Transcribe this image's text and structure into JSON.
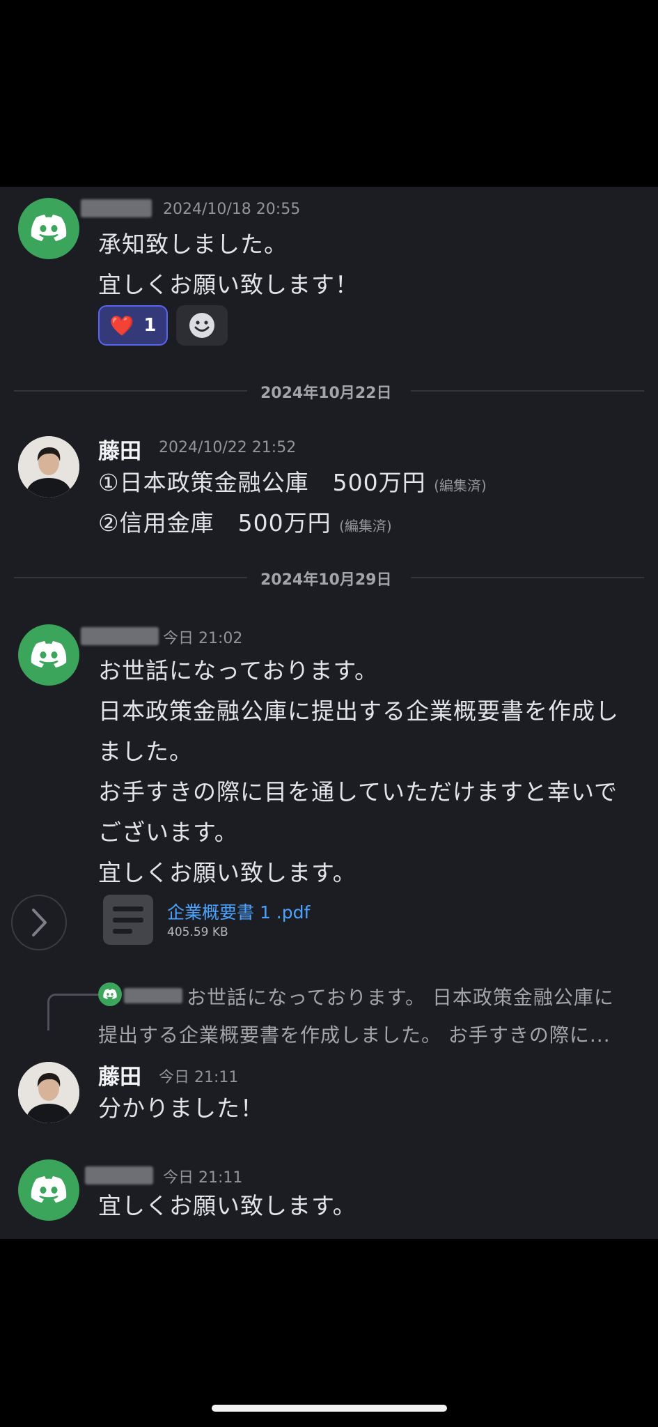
{
  "colors": {
    "background": "#1c1d22",
    "discord_green": "#3ba55c",
    "reaction_border": "#5865f2",
    "link": "#4aa3ff"
  },
  "messages": [
    {
      "timestamp": "2024/10/18 20:55",
      "lines": [
        "承知致しました。",
        "宜しくお願い致します！"
      ],
      "reaction": {
        "emoji": "❤️",
        "count": "1"
      }
    },
    {
      "username": "藤田",
      "timestamp": "2024/10/22 21:52",
      "lines": [
        "①日本政策金融公庫　500万円",
        "②信用金庫　500万円"
      ],
      "edited_label": "(編集済)"
    },
    {
      "timestamp": "今日 21:02",
      "lines": [
        "お世話になっております。",
        "日本政策金融公庫に提出する企業概要書を作成し",
        "ました。",
        "お手すきの際に目を通していただけますと幸いで",
        "ございます。",
        "宜しくお願い致します。"
      ],
      "attachment": {
        "name": "企業概要書 1 .pdf",
        "size": "405.59 KB"
      }
    },
    {
      "reply_preview": {
        "line1": "お世話になっております。 日本政策金融公庫に",
        "line2": "提出する企業概要書を作成しました。 お手すきの際に..."
      },
      "username": "藤田",
      "timestamp": "今日 21:11",
      "lines": [
        "分かりました！"
      ]
    },
    {
      "timestamp": "今日 21:11",
      "lines": [
        "宜しくお願い致します。"
      ]
    }
  ],
  "date_dividers": [
    "2024年10月22日",
    "2024年10月29日"
  ],
  "icons": {
    "discord": "discord-logo-icon",
    "add_reaction": "smiley-add-reaction-icon",
    "file": "file-document-icon",
    "arrow": "chevron-right-icon"
  }
}
